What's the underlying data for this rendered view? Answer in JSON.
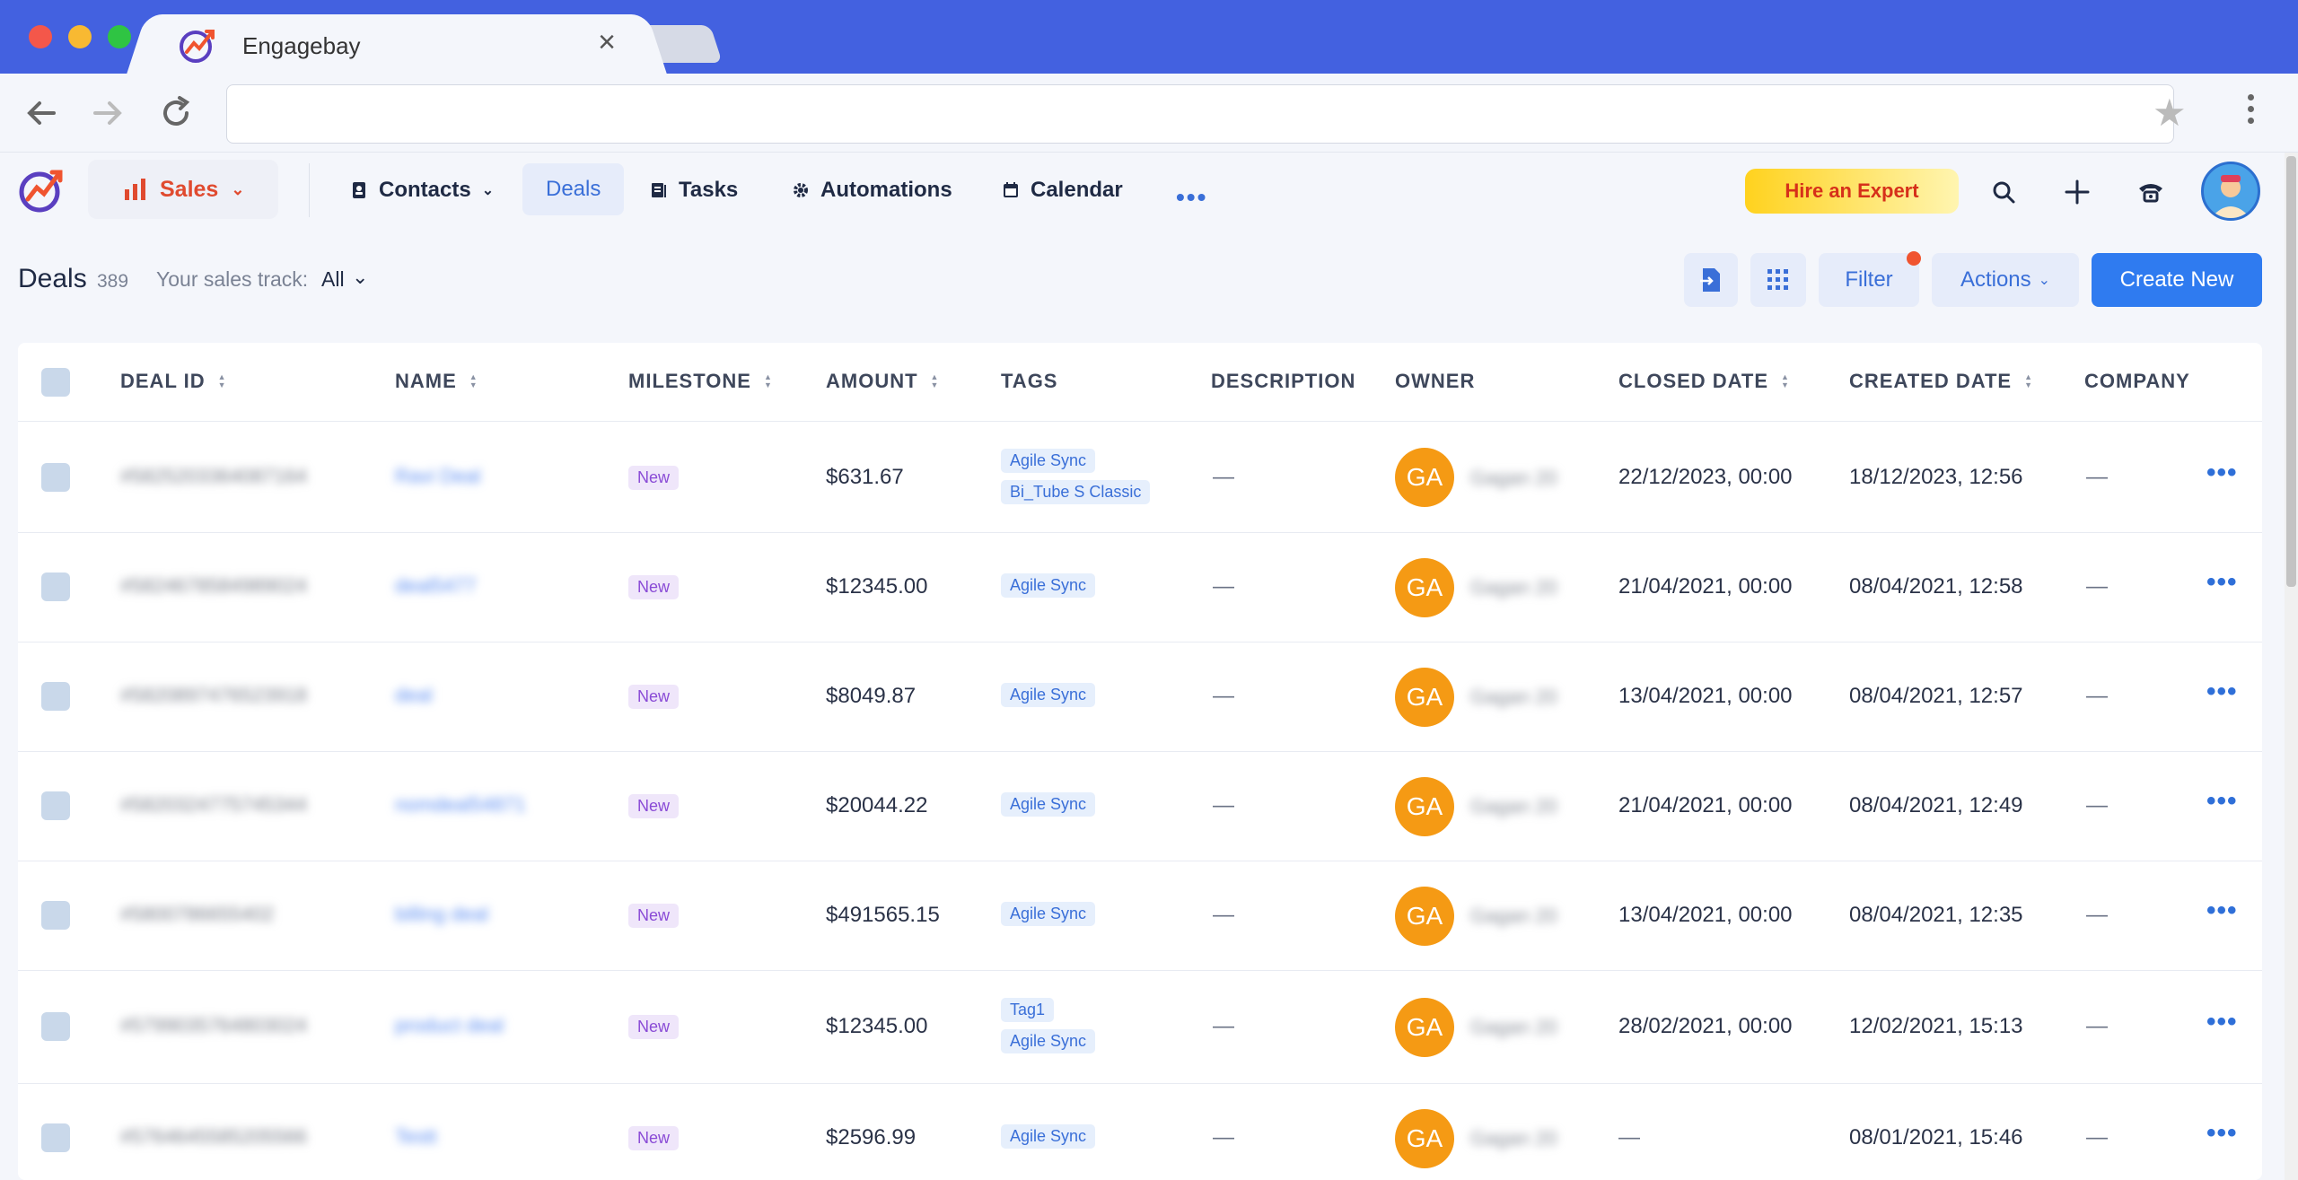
{
  "browser": {
    "tab_title": "Engagebay",
    "url": ""
  },
  "app": {
    "sales_label": "Sales",
    "nav": [
      {
        "label": "Contacts",
        "icon": "contacts-icon"
      },
      {
        "label": "Deals",
        "icon": ""
      },
      {
        "label": "Tasks",
        "icon": "tasks-icon"
      },
      {
        "label": "Automations",
        "icon": "gear-icon"
      },
      {
        "label": "Calendar",
        "icon": "calendar-icon"
      }
    ],
    "hire_label": "Hire an Expert"
  },
  "page": {
    "title": "Deals",
    "count": "389",
    "track_label": "Your sales track:",
    "track_value": "All",
    "filter_label": "Filter",
    "actions_label": "Actions",
    "create_label": "Create New"
  },
  "table": {
    "columns": [
      "DEAL ID",
      "NAME",
      "MILESTONE",
      "AMOUNT",
      "TAGS",
      "DESCRIPTION",
      "OWNER",
      "CLOSED DATE",
      "CREATED DATE",
      "COMPANY"
    ],
    "rows": [
      {
        "id": "#5825203364087164",
        "name": "Ravi Deal",
        "milestone": "New",
        "amount": "$631.67",
        "tags": [
          "Agile Sync",
          "Bi_Tube S Classic"
        ],
        "description": "—",
        "owner_initials": "GA",
        "owner_name": "Gagan 20",
        "closed": "22/12/2023, 00:00",
        "created": "18/12/2023, 12:56",
        "company": "—"
      },
      {
        "id": "#5824678584989024",
        "name": "deal5477",
        "milestone": "New",
        "amount": "$12345.00",
        "tags": [
          "Agile Sync"
        ],
        "description": "—",
        "owner_initials": "GA",
        "owner_name": "Gagan 20",
        "closed": "21/04/2021, 00:00",
        "created": "08/04/2021, 12:58",
        "company": "—"
      },
      {
        "id": "#5820897476523918",
        "name": "deal",
        "milestone": "New",
        "amount": "$8049.87",
        "tags": [
          "Agile Sync"
        ],
        "description": "—",
        "owner_initials": "GA",
        "owner_name": "Gagan 20",
        "closed": "13/04/2021, 00:00",
        "created": "08/04/2021, 12:57",
        "company": "—"
      },
      {
        "id": "#5820324775745344",
        "name": "nomdeal54871",
        "milestone": "New",
        "amount": "$20044.22",
        "tags": [
          "Agile Sync"
        ],
        "description": "—",
        "owner_initials": "GA",
        "owner_name": "Gagan 20",
        "closed": "21/04/2021, 00:00",
        "created": "08/04/2021, 12:49",
        "company": "—"
      },
      {
        "id": "#5800786655402",
        "name": "billing deal",
        "milestone": "New",
        "amount": "$491565.15",
        "tags": [
          "Agile Sync"
        ],
        "description": "—",
        "owner_initials": "GA",
        "owner_name": "Gagan 20",
        "closed": "13/04/2021, 00:00",
        "created": "08/04/2021, 12:35",
        "company": "—"
      },
      {
        "id": "#5799035764803024",
        "name": "product deal",
        "milestone": "New",
        "amount": "$12345.00",
        "tags": [
          "Tag1",
          "Agile Sync"
        ],
        "description": "—",
        "owner_initials": "GA",
        "owner_name": "Gagan 20",
        "closed": "28/02/2021, 00:00",
        "created": "12/02/2021, 15:13",
        "company": "—"
      },
      {
        "id": "#5764645585205566",
        "name": "Testt",
        "milestone": "New",
        "amount": "$2596.99",
        "tags": [
          "Agile Sync"
        ],
        "description": "—",
        "owner_initials": "GA",
        "owner_name": "Gagan 20",
        "closed": "—",
        "created": "08/01/2021, 15:46",
        "company": "—"
      }
    ]
  },
  "colors": {
    "titlebar": "#4361e0",
    "accent": "#2f7bf0",
    "owner_avatar": "#f59a14",
    "sales": "#e04a2f"
  }
}
